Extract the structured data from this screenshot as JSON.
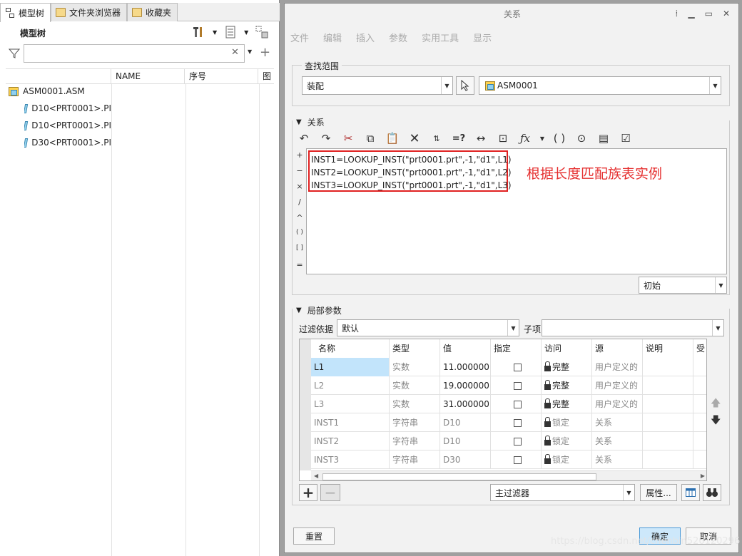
{
  "left_panel": {
    "tabs": [
      {
        "label": "模型树",
        "icon": "model-tree-icon"
      },
      {
        "label": "文件夹浏览器",
        "icon": "folder-browser-icon"
      },
      {
        "label": "收藏夹",
        "icon": "favorites-icon"
      }
    ],
    "title": "模型树",
    "columns": [
      "NAME",
      "序号",
      "图"
    ],
    "tree": [
      {
        "label": "ASM0001.ASM",
        "icon": "assembly-icon"
      },
      {
        "label": "D10<PRT0001>.PI",
        "icon": "part-icon"
      },
      {
        "label": "D10<PRT0001>.PI",
        "icon": "part-icon"
      },
      {
        "label": "D30<PRT0001>.PI",
        "icon": "part-icon"
      }
    ],
    "search_value": ""
  },
  "dialog": {
    "title": "关系",
    "menu": [
      "文件",
      "编辑",
      "插入",
      "参数",
      "实用工具",
      "显示"
    ],
    "scope": {
      "label": "查找范围",
      "type_value": "装配",
      "object_value": "ASM0001"
    },
    "relations": {
      "header": "关系",
      "lines": [
        "INST1=LOOKUP_INST(\"prt0001.prt\",-1,\"d1\",L1)",
        "INST2=LOOKUP_INST(\"prt0001.prt\",-1,\"d1\",L2)",
        "INST3=LOOKUP_INST(\"prt0001.prt\",-1,\"d1\",L3)"
      ],
      "annotation": "根据长度匹配族表实例",
      "operators": [
        "+",
        "−",
        "×",
        "/",
        "^",
        "( )",
        "[ ]",
        "="
      ],
      "mode_value": "初始"
    },
    "params": {
      "header": "局部参数",
      "filter_label": "过滤依据",
      "filter_value": "默认",
      "subitem_label": "子项",
      "subitem_value": "",
      "columns": [
        "名称",
        "类型",
        "值",
        "指定",
        "访问",
        "源",
        "说明",
        "受"
      ],
      "rows": [
        {
          "name": "L1",
          "type": "实数",
          "value": "11.000000",
          "access": "完整",
          "source": "用户定义的"
        },
        {
          "name": "L2",
          "type": "实数",
          "value": "19.000000",
          "access": "完整",
          "source": "用户定义的"
        },
        {
          "name": "L3",
          "type": "实数",
          "value": "31.000000",
          "access": "完整",
          "source": "用户定义的"
        },
        {
          "name": "INST1",
          "type": "字符串",
          "value": "D10",
          "access": "锁定",
          "source": "关系"
        },
        {
          "name": "INST2",
          "type": "字符串",
          "value": "D10",
          "access": "锁定",
          "source": "关系"
        },
        {
          "name": "INST3",
          "type": "字符串",
          "value": "D30",
          "access": "锁定",
          "source": "关系"
        }
      ],
      "main_filter_value": "主过滤器",
      "properties_label": "属性..."
    },
    "reset_label": "重置",
    "ok_label": "确定",
    "cancel_label": "取消"
  },
  "watermark": "https://blog.csdn.net/chenbin520120296"
}
